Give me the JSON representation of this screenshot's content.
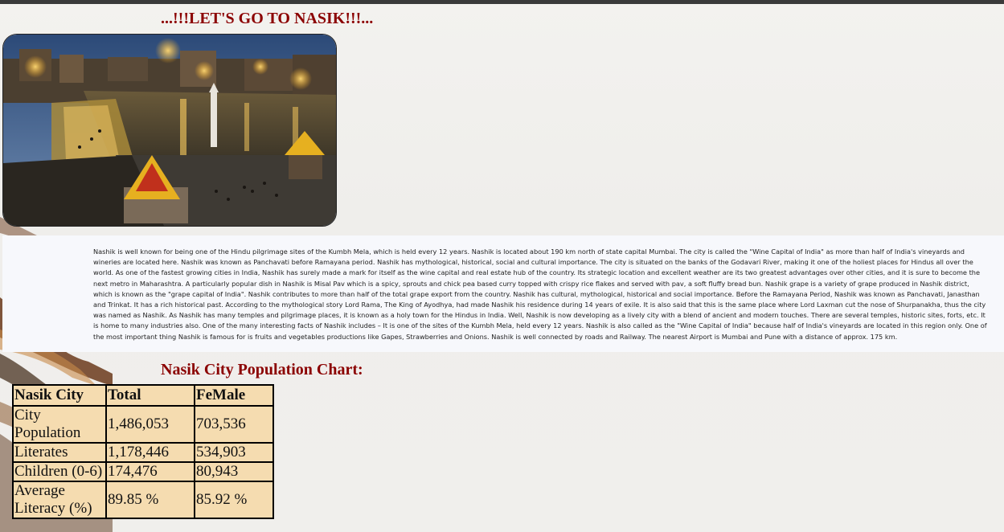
{
  "page": {
    "heading": "...!!!LET'S GO TO NASIK!!!...",
    "chart_heading": "Nasik City Population Chart:"
  },
  "description": "Nashik is well known for being one of the Hindu pilgrimage sites of the Kumbh Mela, which is held every 12 years. Nashik is located about 190 km north of state capital Mumbai. The city is called the \"Wine Capital of India\" as more than half of India's vineyards and wineries are located here. Nashik was known as Panchavati before Ramayana period. Nashik has mythological, historical, social and cultural importance. The city is situated on the banks of the Godavari River, making it one of the holiest places for Hindus all over the world. As one of the fastest growing cities in India, Nashik has surely made a mark for itself as the wine capital and real estate hub of the country. Its strategic location and excellent weather are its two greatest advantages over other cities, and it is sure to become the next metro in Maharashtra. A particularly popular dish in Nashik is Misal Pav which is a spicy, sprouts and chick pea based curry topped with crispy rice flakes and served with pav, a soft fluffy bread bun. Nashik grape is a variety of grape produced in Nashik district, which is known as the \"grape capital of India\". Nashik contributes to more than half of the total grape export from the country. Nashik has cultural, mythological, historical and social importance. Before the Ramayana Period, Nashik was known as Panchavati, Janasthan and Trinkat. It has a rich historical past. According to the mythological story Lord Rama, The King of Ayodhya, had made Nashik his residence during 14 years of exile. It is also said that this is the same place where Lord Laxman cut the nose of Shurpanakha, thus the city was named as Nashik. As Nashik has many temples and pilgrimage places, it is known as a holy town for the Hindus in India. Well, Nashik is now developing as a lively city with a blend of ancient and modern touches. There are several temples, historic sites, forts, etc. It is home to many industries also. One of the many interesting facts of Nashik includes – It is one of the sites of the Kumbh Mela, held every 12 years. Nashik is also called as the \"Wine Capital of India\" because half of India's vineyards are located in this region only. One of the most important thing Nashik is famous for is fruits and vegetables productions like Gapes, Strawberries and Onions. Nashik is well connected by roads and Railway. The nearest Airport is Mumbai and Pune with a distance of approx. 175 km.",
  "table": {
    "headers": [
      "Nasik City",
      "Total",
      "FeMale"
    ],
    "rows": [
      [
        "City Population",
        "1,486,053",
        "703,536"
      ],
      [
        "Literates",
        "1,178,446",
        "534,903"
      ],
      [
        "Children (0-6)",
        "174,476",
        "80,943"
      ],
      [
        "Average Literacy (%)",
        "89.85 %",
        "85.92 %"
      ]
    ]
  },
  "colors": {
    "heading": "#8b0000",
    "table_background": "#f5dcb0",
    "panel_background": "#f7f8fc"
  }
}
